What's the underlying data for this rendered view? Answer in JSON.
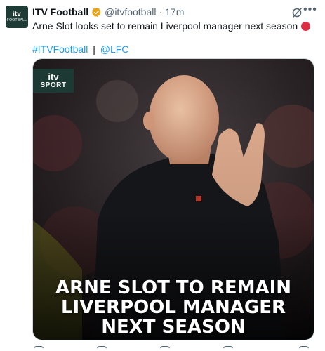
{
  "account": {
    "name": "ITV Football",
    "handle": "@itvfootball",
    "separator": "·",
    "time": "17m",
    "avatar_line1": "itv",
    "avatar_line2": "FOOTBALL",
    "verified_color": "#e8a317"
  },
  "tweet": {
    "text": "Arne Slot looks set to remain Liverpool manager next season",
    "hashtag": "#ITVFootball",
    "separator": "|",
    "mention": "@LFC",
    "link_color": "#1d9bf0"
  },
  "media": {
    "badge_line1": "itv",
    "badge_line2": "SPORT",
    "headline": [
      "ARNE SLOT TO REMAIN",
      "LIVERPOOL MANAGER",
      "NEXT SEASON"
    ]
  },
  "icons": {
    "more": "more-icon",
    "grok": "grok-icon"
  }
}
